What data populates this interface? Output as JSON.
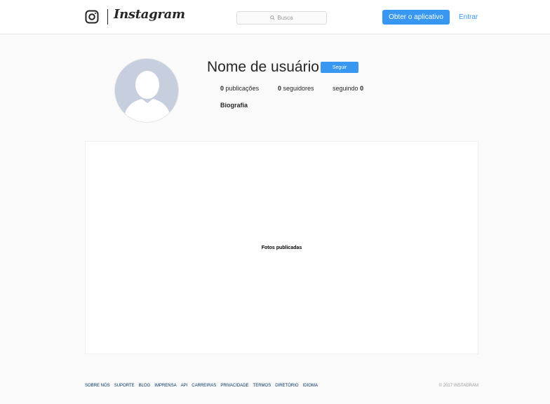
{
  "header": {
    "logo_text": "Instagram",
    "search_placeholder": "Busca",
    "get_app_label": "Obter o aplicativo",
    "login_label": "Entrar"
  },
  "profile": {
    "username": "Nome de usuário",
    "follow_label": "Seguir",
    "posts_count": "0",
    "posts_label": "publicações",
    "followers_count": "0",
    "followers_label": "seguidores",
    "following_label": "seguindo",
    "following_count": "0",
    "bio": "Biografia"
  },
  "photos": {
    "label": "Fotos publicadas"
  },
  "footer": {
    "links": [
      "Sobre nós",
      "Suporte",
      "Blog",
      "Imprensa",
      "API",
      "Carreiras",
      "Privacidade",
      "Termos",
      "Diretório",
      "Idioma"
    ],
    "copyright": "© 2017 INSTAGRAM"
  },
  "colors": {
    "accent": "#3897f0",
    "avatar_bg": "#c7cfdf",
    "link": "#003569"
  }
}
